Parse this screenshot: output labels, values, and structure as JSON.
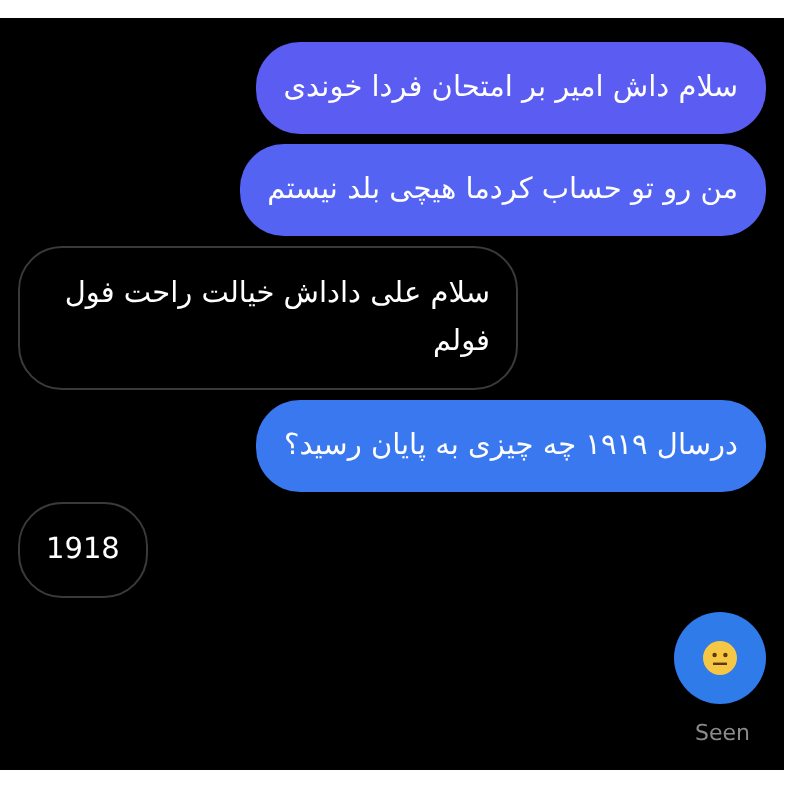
{
  "messages": [
    {
      "kind": "sent",
      "text": "سلام داش امیر بر امتحان فردا خوندی",
      "color": "#5a5cf2"
    },
    {
      "kind": "sent",
      "text": "من رو تو حساب کردما هیچی بلد نیستم",
      "color": "#5563f3"
    },
    {
      "kind": "received",
      "text": "سلام علی داداش خیالت راحت فول فولم"
    },
    {
      "kind": "sent",
      "text": "درسال ۱۹۱۹ چه چیزی به پایان رسید؟",
      "color": "#3a78f0"
    },
    {
      "kind": "received",
      "text": "1918"
    },
    {
      "kind": "emoji",
      "color": "#2f7bea"
    }
  ],
  "status": "Seen"
}
